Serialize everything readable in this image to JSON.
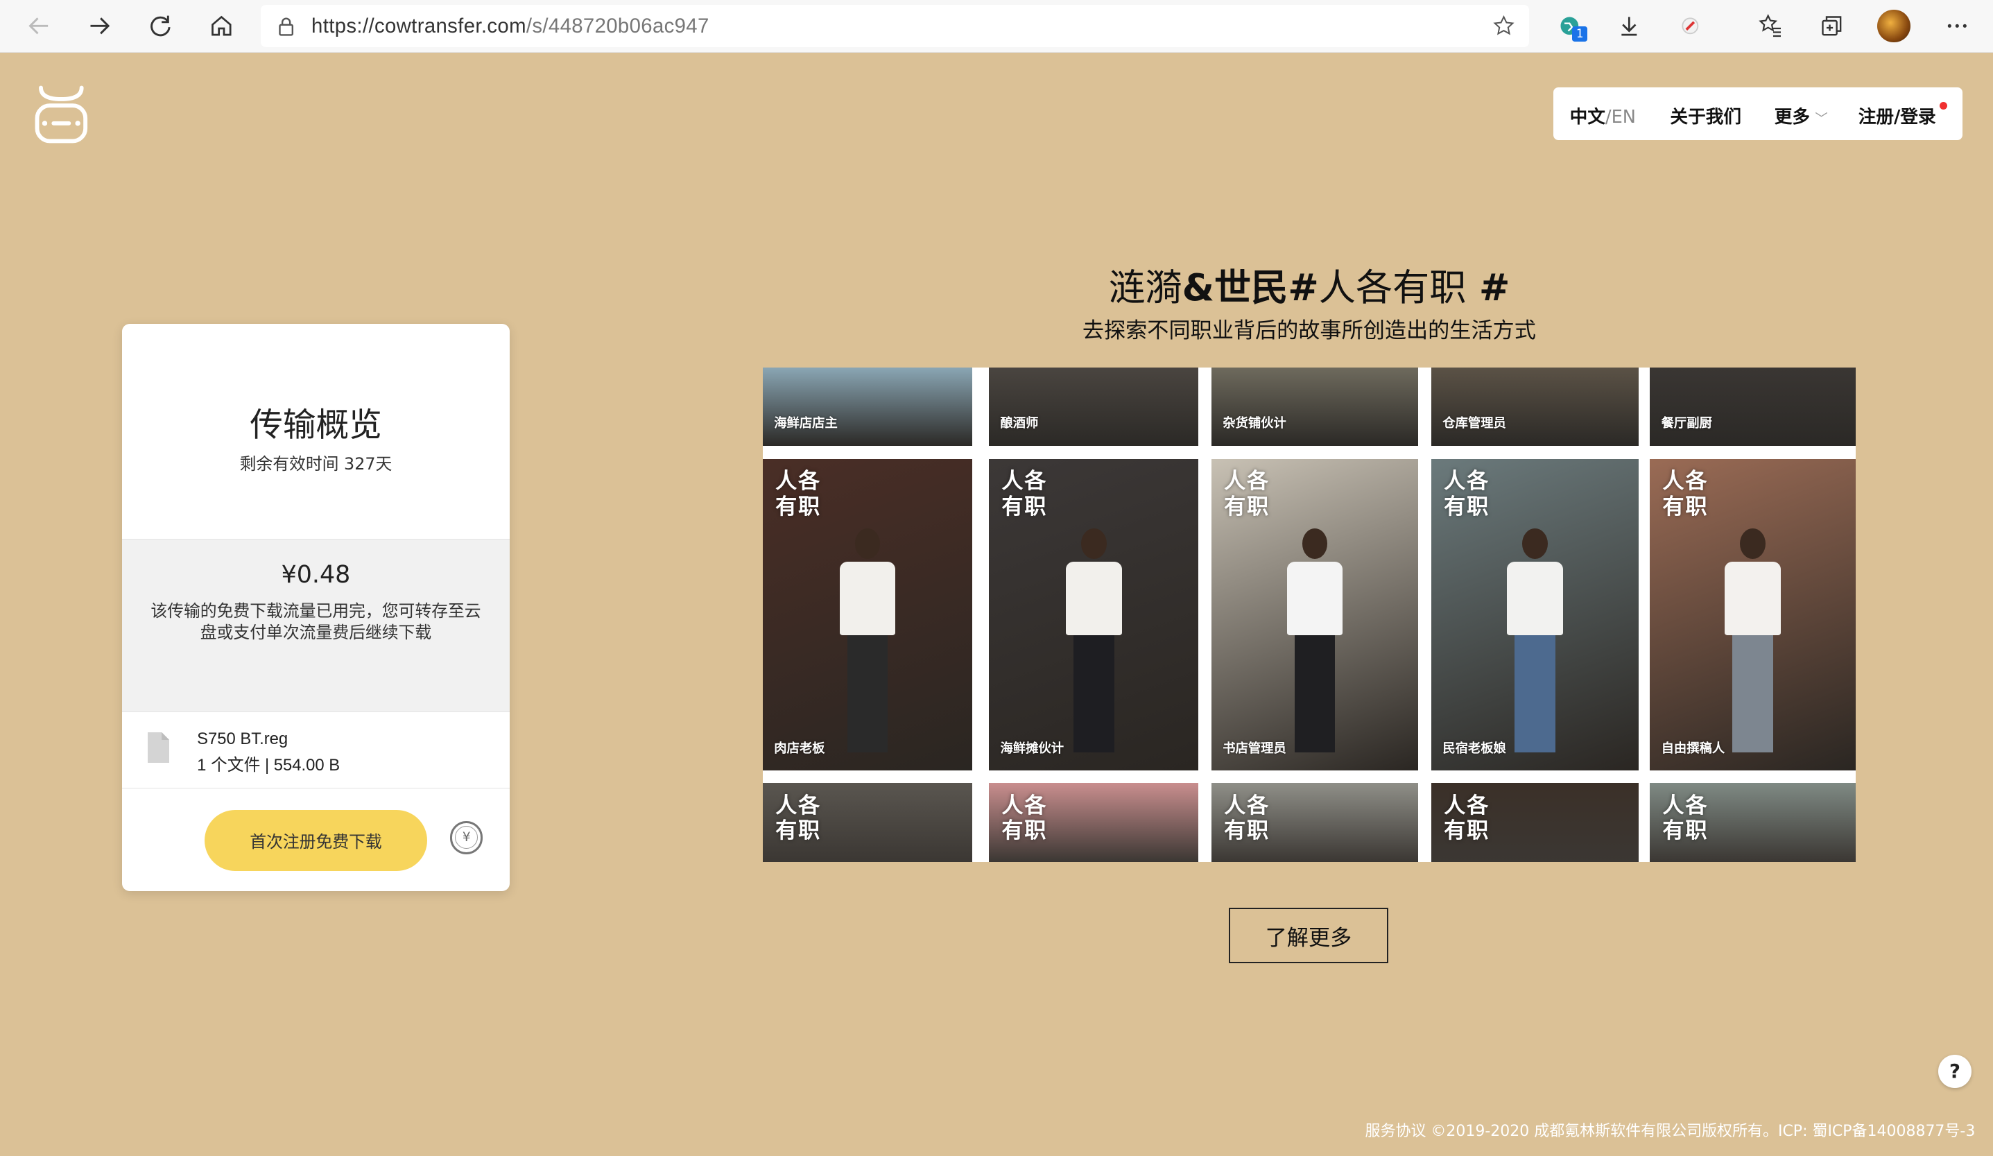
{
  "browser": {
    "url_prefix": "https://cowtransfer.com",
    "url_path": "/s/448720b06ac947",
    "ext_badge_count": "1"
  },
  "nav": {
    "lang_zh": "中文",
    "lang_sep": "/",
    "lang_en": "EN",
    "about": "关于我们",
    "more": "更多",
    "more_chevron": "﹀",
    "login": "注册/登录"
  },
  "card": {
    "title": "传输概览",
    "remaining": "剩余有效时间 327天",
    "price": "¥0.48",
    "price_note": "该传输的免费下载流量已用完，您可转存至云盘或支付单次流量费后继续下载",
    "file_name": "S750 BT.reg",
    "file_meta": "1 个文件 | 554.00 B",
    "download_button": "首次注册免费下载",
    "coin_symbol": "¥"
  },
  "promo": {
    "title_a": "涟漪",
    "title_b": "&世民#",
    "title_c": "人各有职",
    "title_d": " #",
    "subtitle": "去探索不同职业背后的故事所创造出的生活方式",
    "brand_text": "人各有职",
    "tiles_top": [
      "海鲜店店主",
      "酿酒师",
      "杂货铺伙计",
      "仓库管理员",
      "餐厅副厨"
    ],
    "tiles_mid": [
      "肉店老板",
      "海鲜摊伙计",
      "书店管理员",
      "民宿老板娘",
      "自由撰稿人"
    ],
    "learn_more": "了解更多"
  },
  "help_icon": "?",
  "footer": {
    "agreement": "服务协议",
    "copyright": " ©2019-2020 成都氪林斯软件有限公司版权所有。ICP: 蜀ICP备14008877号-3"
  }
}
